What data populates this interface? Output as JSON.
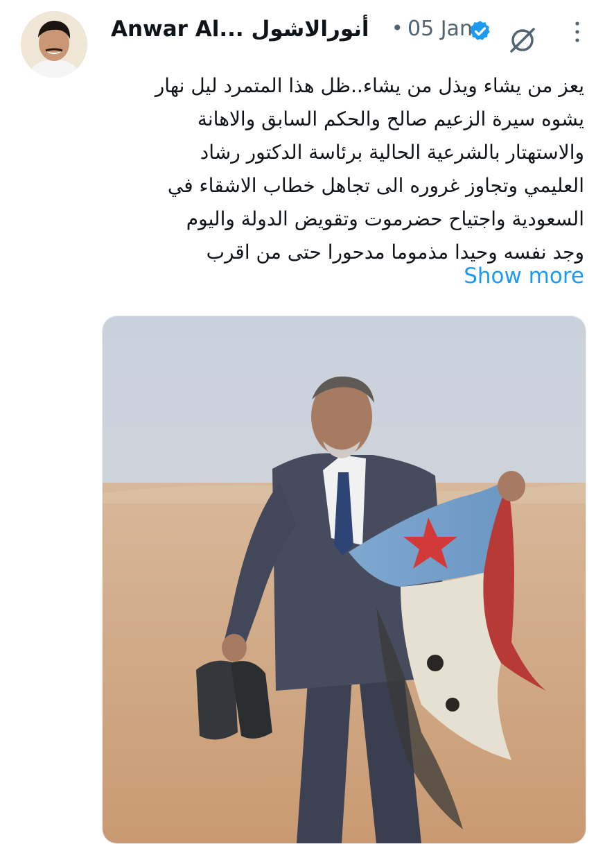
{
  "tweet": {
    "author": {
      "display_name": "Anwar Al... أنورالاشول",
      "verified": true
    },
    "separator": "•",
    "date": "05 Jan",
    "lines": [
      "يعز من يشاء ويذل من يشاء..ظل هذا المتمرد ليل نهار",
      "يشوه سيرة الزعيم صالح والحكم السابق والاهانة",
      "والاستهتار بالشرعية الحالية برئاسة الدكتور رشاد",
      "العليمي وتجاوز غروره الى تجاهل خطاب الاشقاء في",
      "السعودية واجتياح حضرموت وتقويض الدولة واليوم",
      "وجد نفسه وحيدا مذموما مدحورا حتى من اقرب"
    ],
    "show_more": "Show more"
  },
  "icons": {
    "verified": "verified-badge-icon",
    "grok": "grok-icon",
    "more": "more-options-icon"
  },
  "colors": {
    "link": "#1d9bf0",
    "verified": "#1d9bf0",
    "muted": "#536471",
    "text": "#0f1419"
  }
}
